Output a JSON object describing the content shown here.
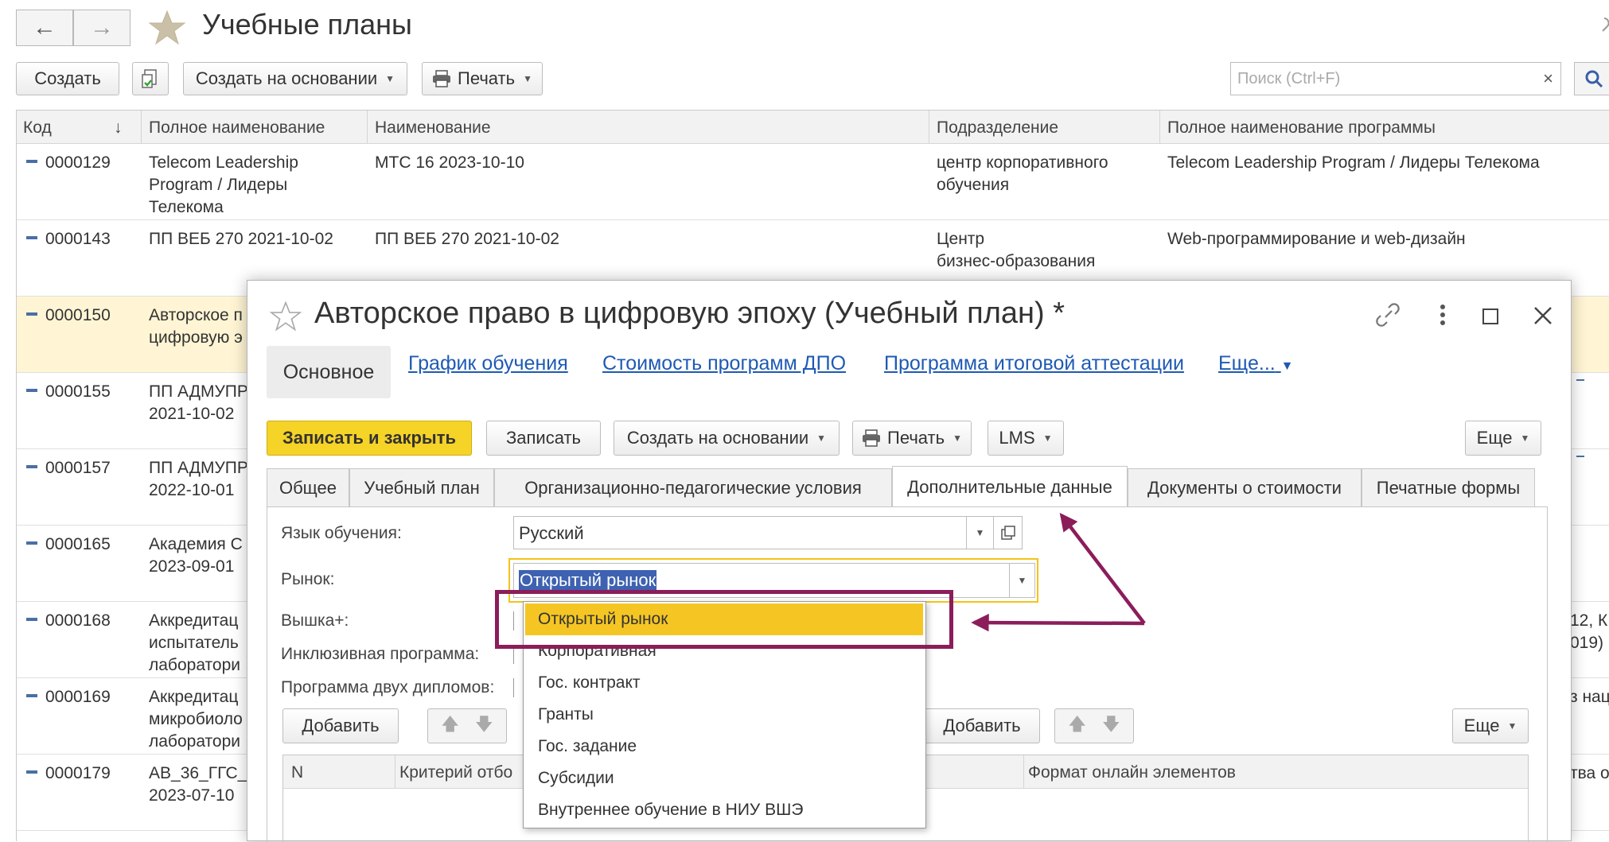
{
  "header": {
    "title": "Учебные планы",
    "create_label": "Создать",
    "create_based_label": "Создать на основании",
    "print_label": "Печать",
    "search_placeholder": "Поиск (Ctrl+F)"
  },
  "grid": {
    "columns": [
      "Код",
      "Полное наименование",
      "Наименование",
      "Подразделение",
      "Полное наименование программы"
    ],
    "rows": [
      {
        "code": "0000129",
        "full": "Telecom Leadership\nProgram / Лидеры\nТелекома",
        "name": "МТС 16 2023-10-10",
        "dept": "центр корпоративного\nобучения",
        "program": "Telecom Leadership Program / Лидеры Телекома",
        "right": ""
      },
      {
        "code": "0000143",
        "full": "ПП ВЕБ 270 2021-10-02",
        "name": "ПП ВЕБ 270 2021-10-02",
        "dept": "Центр\nбизнес-образования",
        "program": "Web-программирование и web-дизайн",
        "right": ""
      },
      {
        "code": "0000150",
        "full": "Авторское п\nцифровую э",
        "name": "",
        "dept": "",
        "program": "",
        "right": ""
      },
      {
        "code": "0000155",
        "full": "ПП АДМУПР\n2021-10-02",
        "name": "",
        "dept": "",
        "program": "",
        "right": ""
      },
      {
        "code": "0000157",
        "full": "ПП АДМУПР\n2022-10-01",
        "name": "",
        "dept": "",
        "program": "",
        "right": ""
      },
      {
        "code": "0000165",
        "full": "Академия С\n2023-09-01",
        "name": "",
        "dept": "",
        "program": "",
        "right": ""
      },
      {
        "code": "0000168",
        "full": "Аккредитац\nиспытатель\nлаборатори",
        "name": "",
        "dept": "",
        "program": "",
        "right": "12, К\n019)"
      },
      {
        "code": "0000169",
        "full": "Аккредитац\nмикробиоло\nлаборатори",
        "name": "",
        "dept": "",
        "program": "",
        "right": "з нац"
      },
      {
        "code": "0000179",
        "full": "АВ_36_ГГС_\n2023-07-10",
        "name": "",
        "dept": "",
        "program": "",
        "right": "тва о"
      }
    ]
  },
  "dialog": {
    "title": "Авторское право в цифровую эпоху (Учебный план) *",
    "nav_tabs": [
      "Основное",
      "График обучения",
      "Стоимость программ ДПО",
      "Программа итоговой аттестации",
      "Еще..."
    ],
    "toolbar": {
      "save_close": "Записать и закрыть",
      "save": "Записать",
      "create_based": "Создать на основании",
      "print": "Печать",
      "lms": "LMS",
      "more": "Еще"
    },
    "form_tabs": [
      "Общее",
      "Учебный план",
      "Организационно-педагогические условия",
      "Дополнительные данные",
      "Документы о стоимости",
      "Печатные формы"
    ],
    "fields": {
      "language_label": "Язык обучения:",
      "language_value": "Русский",
      "market_label": "Рынок:",
      "market_value": "Открытый рынок",
      "vyshka_label": "Вышка+:",
      "inclusive_label": "Инклюзивная программа:",
      "two_diplomas_label": "Программа двух дипломов:"
    },
    "table_toolbar": {
      "add": "Добавить",
      "add2": "Добавить",
      "more": "Еще"
    },
    "table_columns": [
      "N",
      "Критерий отбо",
      "Формат онлайн элементов"
    ],
    "dropdown_options": [
      "Открытый рынок",
      "Корпоративная",
      "Гос. контракт",
      "Гранты",
      "Гос. задание",
      "Субсидии",
      "Внутреннее обучение в НИУ ВШЭ"
    ]
  },
  "colors": {
    "highlight_row": "#fff5d4",
    "accent_yellow": "#f6d22b",
    "annotation": "#8b1d5b",
    "link_blue": "#1e5ab4"
  }
}
